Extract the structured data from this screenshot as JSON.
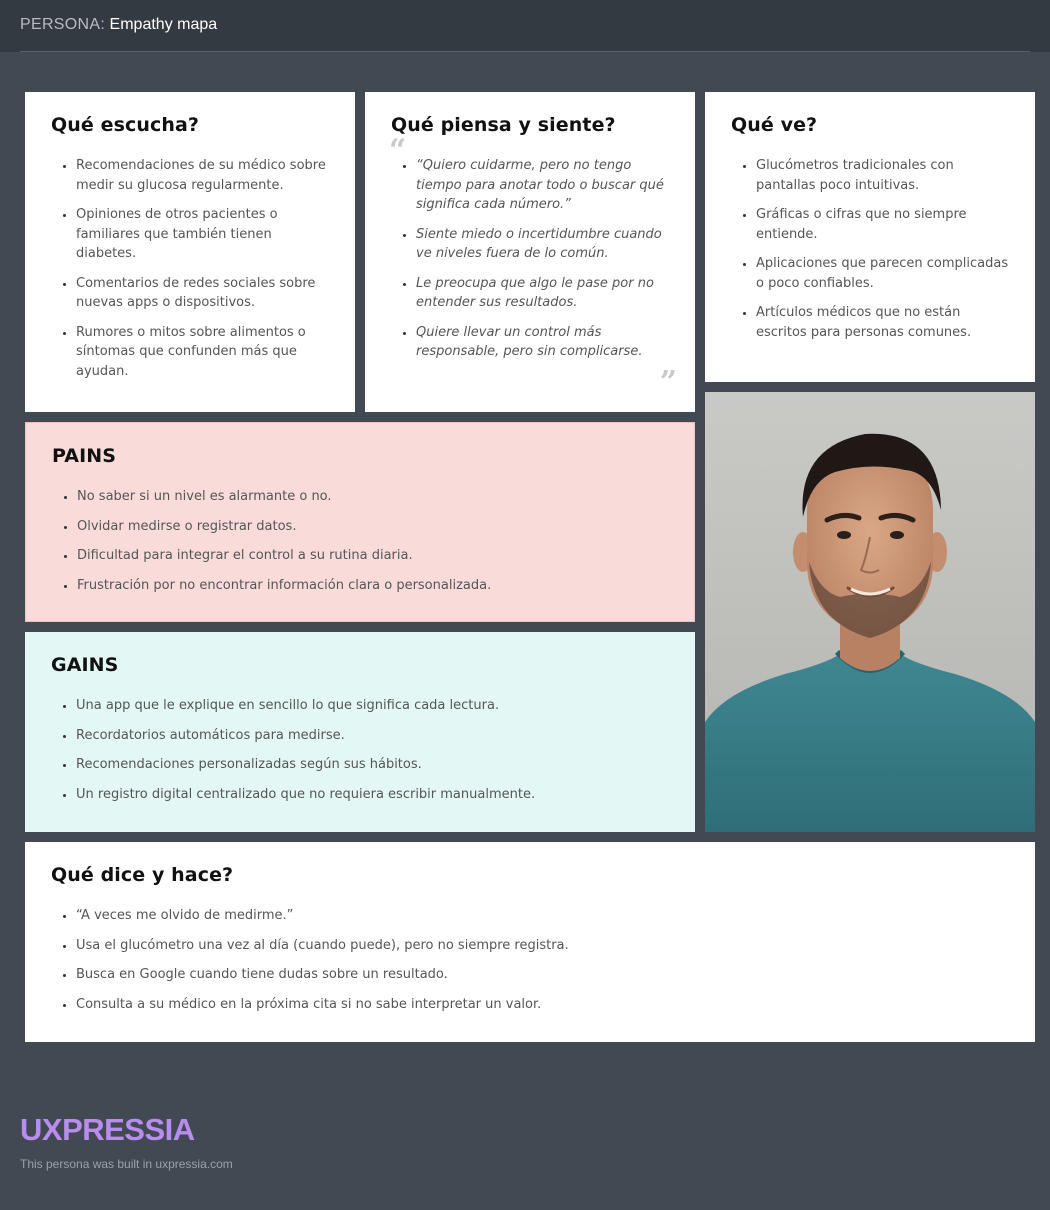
{
  "header": {
    "prefix": "PERSONA:",
    "title": "Empathy mapa"
  },
  "hears": {
    "title": "Qué escucha?",
    "items": [
      "Recomendaciones de su médico sobre medir su glucosa regularmente.",
      "Opiniones de otros pacientes o familiares que también tienen diabetes.",
      "Comentarios de redes sociales sobre nuevas apps o dispositivos.",
      "Rumores o mitos sobre alimentos o síntomas que confunden más que ayudan."
    ]
  },
  "thinks": {
    "title": "Qué piensa y siente?",
    "quote_open": "“",
    "quote_close": "”",
    "items": [
      "“Quiero cuidarme, pero no tengo tiempo para anotar todo o buscar qué significa cada número.”",
      "Siente miedo o incertidumbre cuando ve niveles fuera de lo común.",
      "Le preocupa que algo le pase por no entender sus resultados.",
      "Quiere llevar un control más responsable, pero sin complicarse."
    ]
  },
  "sees": {
    "title": "Qué ve?",
    "items": [
      "Glucómetros tradicionales con pantallas poco intuitivas.",
      "Gráficas o cifras que no siempre entiende.",
      "Aplicaciones que parecen complicadas o poco confiables.",
      "Artículos médicos que no están escritos para personas comunes."
    ]
  },
  "pains": {
    "title": "PAINS",
    "items": [
      "No saber si un nivel es alarmante o no.",
      "Olvidar medirse o registrar datos.",
      "Dificultad para integrar el control a su rutina diaria.",
      "Frustración por no encontrar información clara o personalizada."
    ]
  },
  "gains": {
    "title": "GAINS",
    "items": [
      "Una app que le explique en sencillo lo que significa cada lectura.",
      "Recordatorios automáticos para medirse.",
      "Recomendaciones personalizadas según sus hábitos.",
      "Un registro digital centralizado que no requiera escribir manualmente."
    ]
  },
  "says": {
    "title": "Qué dice y hace?",
    "items": [
      "“A veces me olvido de medirme.”",
      "Usa el glucómetro una vez al día (cuando puede), pero no siempre registra.",
      "Busca en Google cuando tiene dudas sobre un resultado.",
      "Consulta a su médico en la próxima cita si no sabe interpretar un valor."
    ]
  },
  "footer": {
    "logo": "UXPRESSIA",
    "note": "This persona was built in uxpressia.com"
  },
  "colors": {
    "background": "#434952",
    "topbar": "#343a41",
    "pains_bg": "#f9dcd9",
    "gains_bg": "#e3f8f4",
    "logo": "#b98cf0"
  },
  "icons": [
    "open-quote-icon",
    "close-quote-icon"
  ]
}
